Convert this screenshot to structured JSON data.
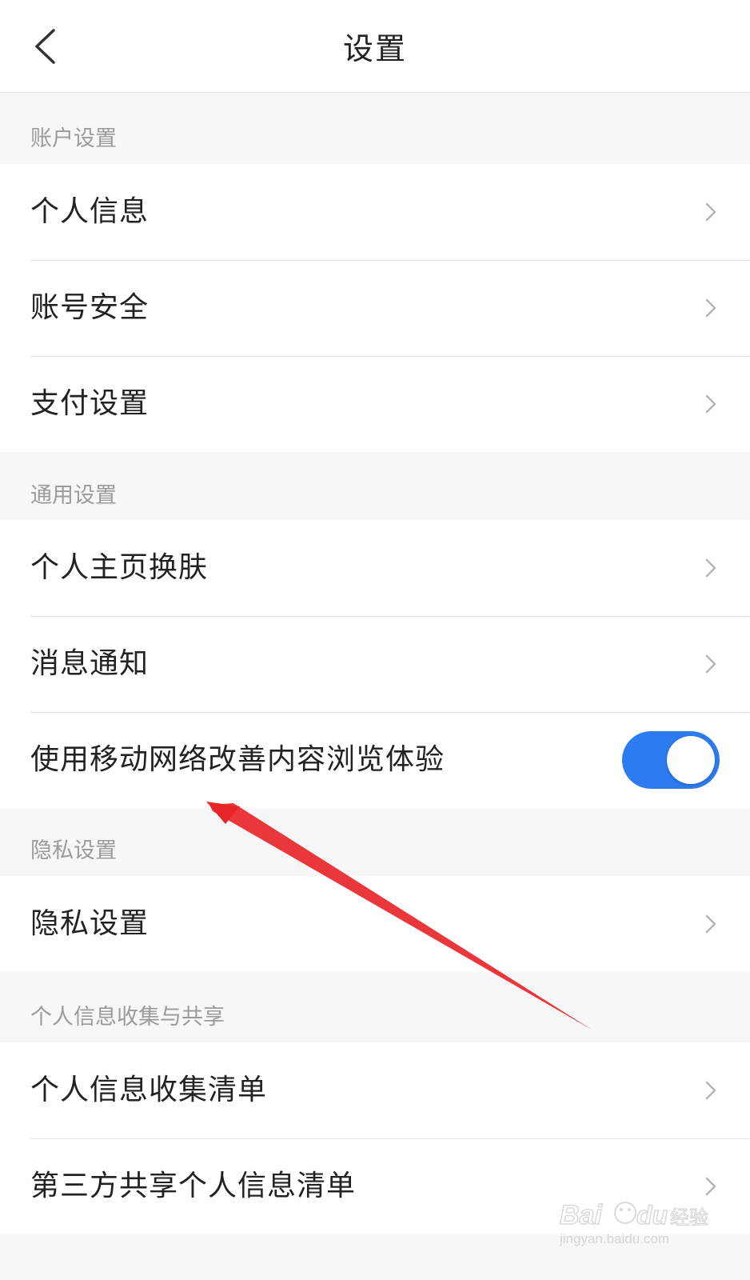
{
  "header": {
    "title": "设置",
    "back_icon": "chevron-left-icon"
  },
  "sections": {
    "account": {
      "title": "账户设置",
      "items": [
        {
          "label": "个人信息"
        },
        {
          "label": "账号安全"
        },
        {
          "label": "支付设置"
        }
      ]
    },
    "general": {
      "title": "通用设置",
      "items": [
        {
          "label": "个人主页换肤"
        },
        {
          "label": "消息通知"
        },
        {
          "label": "使用移动网络改善内容浏览体验",
          "toggle_on": true
        }
      ]
    },
    "privacy": {
      "title": "隐私设置",
      "items": [
        {
          "label": "隐私设置"
        }
      ]
    },
    "personal_info": {
      "title": "个人信息收集与共享",
      "items": [
        {
          "label": "个人信息收集清单"
        },
        {
          "label": "第三方共享个人信息清单"
        }
      ]
    }
  },
  "colors": {
    "toggle_on": "#2d7bf0",
    "annotation_arrow": "#e8262a",
    "background": "#f7f7f7"
  },
  "watermark": {
    "brand": "Bai du 经验",
    "url": "jingyan.baidu.com"
  }
}
